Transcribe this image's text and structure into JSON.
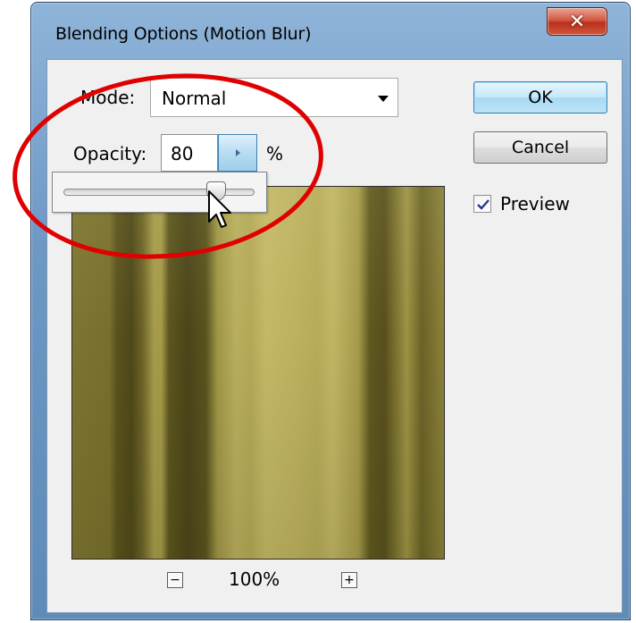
{
  "window": {
    "title": "Blending Options (Motion Blur)",
    "close_glyph": "✕"
  },
  "mode": {
    "label": "Mode:",
    "value": "Normal"
  },
  "opacity": {
    "label": "Opacity:",
    "value": "80",
    "unit": "%",
    "slider_value_percent": 80
  },
  "buttons": {
    "ok": "OK",
    "cancel": "Cancel"
  },
  "preview": {
    "label": "Preview",
    "checked": true
  },
  "zoom": {
    "level": "100%",
    "minus_glyph": "−",
    "plus_glyph": "+"
  },
  "colors": {
    "annotation_circle": "#e00000",
    "ok_button_border": "#3c7fb1"
  }
}
